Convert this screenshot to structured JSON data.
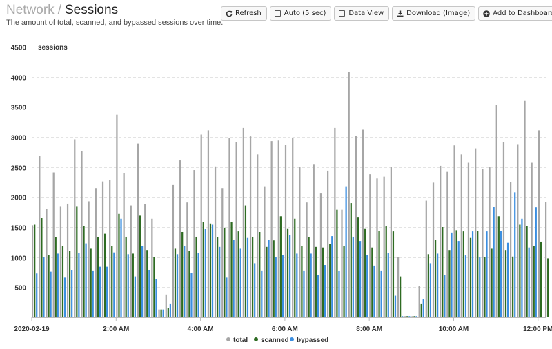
{
  "breadcrumb": {
    "parent": "Network",
    "separator": "/",
    "current": "Sessions"
  },
  "subtitle": "The amount of total, scanned, and bypassed sessions over time.",
  "toolbar": {
    "refresh": "Refresh",
    "auto": "Auto (5 sec)",
    "data_view": "Data View",
    "download": "Download (Image)",
    "add_dashboard": "Add to Dashboard"
  },
  "icons": {
    "refresh": "refresh-icon",
    "auto": "checkbox-icon",
    "data_view": "checkbox-icon",
    "download": "download-icon",
    "add_dashboard": "plus-circle-icon"
  },
  "chart_data": {
    "type": "bar",
    "ylabel": "sessions",
    "ylim": [
      0,
      4500
    ],
    "yticks": [
      500,
      1000,
      1500,
      2000,
      2500,
      3000,
      3500,
      4000,
      4500
    ],
    "xlim": [
      0,
      12.2
    ],
    "xtick_positions": [
      0,
      2,
      4,
      6,
      8,
      10,
      12
    ],
    "xtick_labels": [
      "2020-02-19",
      "2:00 AM",
      "4:00 AM",
      "6:00 AM",
      "8:00 AM",
      "10:00 AM",
      "12:00 PM"
    ],
    "grid": true,
    "legend_position": "bottom",
    "colors": {
      "total": "#a6a6a6",
      "scanned": "#2e6b22",
      "bypassed": "#3b8ee0"
    },
    "x_hours": [
      0.0,
      0.167,
      0.333,
      0.5,
      0.667,
      0.833,
      1.0,
      1.167,
      1.333,
      1.5,
      1.667,
      1.833,
      2.0,
      2.167,
      2.333,
      2.5,
      2.667,
      2.833,
      3.0,
      3.167,
      3.333,
      3.5,
      3.667,
      3.833,
      4.0,
      4.167,
      4.333,
      4.5,
      4.667,
      4.833,
      5.0,
      5.167,
      5.333,
      5.5,
      5.667,
      5.833,
      6.0,
      6.167,
      6.333,
      6.5,
      6.667,
      6.833,
      7.0,
      7.167,
      7.333,
      7.5,
      7.667,
      7.833,
      8.0,
      8.167,
      8.333,
      8.5,
      8.667,
      8.833,
      9.0,
      9.167,
      9.333,
      9.5,
      9.667,
      9.833,
      10.0,
      10.167,
      10.333,
      10.5,
      10.667,
      10.833,
      11.0,
      11.167,
      11.333,
      11.5,
      11.667,
      11.833,
      12.0,
      12.167
    ],
    "series": [
      {
        "name": "total",
        "values": [
          1530,
          2680,
          1800,
          2410,
          1850,
          1890,
          2960,
          2760,
          1930,
          2150,
          2260,
          2290,
          3370,
          2400,
          1860,
          2890,
          1880,
          1640,
          130,
          380,
          2200,
          2610,
          1910,
          2450,
          3040,
          3110,
          2510,
          2150,
          2980,
          2910,
          3150,
          3010,
          2710,
          2180,
          2930,
          2940,
          2870,
          2990,
          2500,
          1910,
          2550,
          2060,
          2440,
          3150,
          1790,
          4080,
          3020,
          3120,
          2380,
          2310,
          2340,
          2500,
          1000,
          20,
          20,
          520,
          1940,
          2240,
          2520,
          2420,
          2860,
          2710,
          2570,
          2810,
          2470,
          2500,
          3530,
          2910,
          2250,
          2880,
          3610,
          2570,
          3110,
          1920
        ]
      },
      {
        "name": "scanned",
        "values": [
          1540,
          1660,
          1040,
          1330,
          1180,
          1110,
          1850,
          1520,
          1140,
          1330,
          1390,
          1190,
          1720,
          1340,
          1060,
          1690,
          1120,
          1000,
          130,
          150,
          1140,
          1420,
          1110,
          1340,
          1580,
          1560,
          1330,
          1490,
          1580,
          1430,
          1860,
          1340,
          1420,
          1170,
          1280,
          1680,
          1480,
          1640,
          1190,
          1330,
          1170,
          1160,
          1220,
          1790,
          1180,
          1900,
          1670,
          1480,
          1160,
          1440,
          1520,
          1430,
          680,
          20,
          20,
          230,
          1050,
          1290,
          1500,
          1120,
          1450,
          1430,
          1320,
          1440,
          1000,
          1140,
          1680,
          1120,
          1010,
          1540,
          1520,
          1180,
          1260,
          980
        ]
      },
      {
        "name": "bypassed",
        "values": [
          730,
          1000,
          760,
          1060,
          660,
          790,
          1070,
          1230,
          780,
          840,
          840,
          1080,
          1640,
          1050,
          680,
          1190,
          790,
          640,
          130,
          230,
          1050,
          1180,
          740,
          1070,
          1470,
          1540,
          1170,
          660,
          1290,
          1140,
          1320,
          900,
          780,
          1290,
          1000,
          1040,
          1370,
          1060,
          780,
          1060,
          700,
          870,
          1350,
          770,
          2180,
          1340,
          1270,
          1040,
          860,
          780,
          1070,
          360,
          20,
          20,
          20,
          300,
          900,
          1060,
          700,
          1410,
          1270,
          1030,
          1430,
          1000,
          1430,
          1840,
          1440,
          1240,
          2080,
          1640,
          1160,
          1830,
          0,
          0
        ]
      }
    ]
  }
}
